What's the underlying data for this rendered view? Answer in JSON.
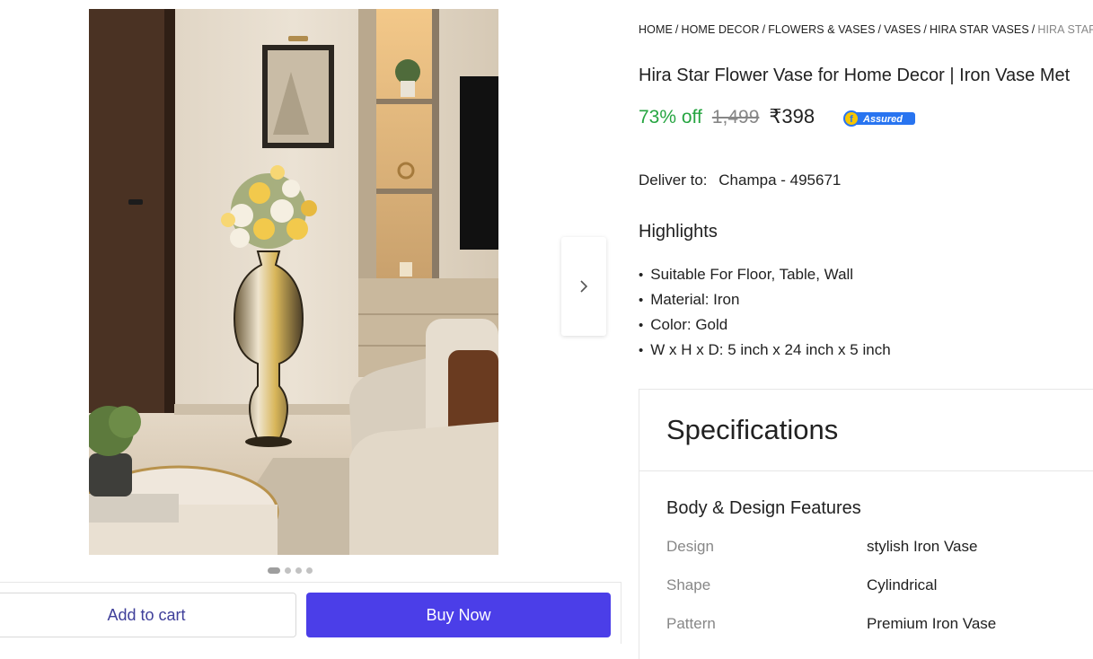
{
  "breadcrumb": [
    {
      "label": "HOME"
    },
    {
      "label": "HOME DECOR"
    },
    {
      "label": "FLOWERS & VASES"
    },
    {
      "label": "VASES"
    },
    {
      "label": "HIRA STAR VASES"
    },
    {
      "label": "HIRA STAR"
    }
  ],
  "product": {
    "title": "Hira Star Flower Vase for Home Decor | Iron Vase Met",
    "discount": "73% off",
    "mrp": "1,499",
    "price": "₹398",
    "assured_label": "Assured"
  },
  "delivery": {
    "label": "Deliver to:",
    "location": "Champa - 495671"
  },
  "highlights": {
    "heading": "Highlights",
    "items": [
      "Suitable For Floor, Table, Wall",
      "Material: Iron",
      "Color: Gold",
      "W x H x D: 5 inch x 24 inch x 5 inch"
    ]
  },
  "specifications": {
    "heading": "Specifications",
    "section": "Body & Design Features",
    "rows": [
      {
        "key": "Design",
        "value": "stylish Iron Vase"
      },
      {
        "key": "Shape",
        "value": "Cylindrical"
      },
      {
        "key": "Pattern",
        "value": "Premium Iron Vase"
      }
    ]
  },
  "gallery": {
    "image_count": 4,
    "active_index": 0
  },
  "actions": {
    "add_to_cart": "Add to cart",
    "buy_now": "Buy Now"
  },
  "colors": {
    "discount": "#26a541",
    "buy_now": "#4b3ee8",
    "add_to_cart_text": "#3f3f9a",
    "assured_badge": "#2874f0"
  },
  "icons": [
    "chevron-right-icon",
    "assured-badge-icon"
  ]
}
